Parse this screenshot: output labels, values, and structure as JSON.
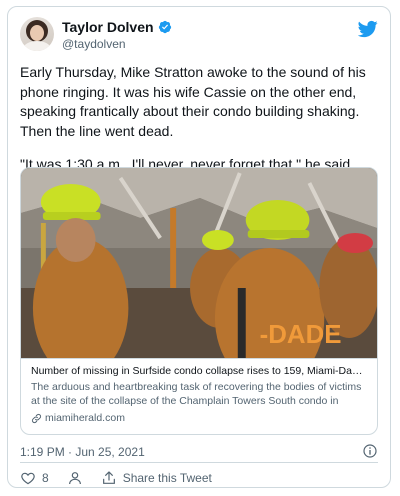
{
  "author": {
    "name": "Taylor Dolven",
    "handle": "@taydolven"
  },
  "tweet": {
    "paragraph_1": "Early Thursday, Mike Stratton awoke to the sound of his phone ringing. It was his wife Cassie on the other end, speaking frantically about their condo building shaking. Then the line went dead.",
    "paragraph_2": "\"It was 1:30 a.m., I'll never, never forget that,\" he said."
  },
  "link_card": {
    "title": "Number of missing in Surfside condo collapse rises to 159, Miami-Dade ...",
    "description": "The arduous and heartbreaking task of recovering the bodies of victims at the site of the collapse of the Champlain Towers South condo in Surfsid...",
    "domain": "miamiherald.com",
    "photo_text": "-DADE"
  },
  "meta": {
    "timestamp": "1:19 PM · Jun 25, 2021"
  },
  "actions": {
    "like_count": "8",
    "share_label": "Share this Tweet"
  },
  "colors": {
    "brand_blue": "#1d9bf0",
    "like_red": "#f91880",
    "text_secondary": "#536471",
    "border": "#cfd9de"
  },
  "icons": [
    "verified-badge-icon",
    "twitter-bird-icon",
    "link-icon",
    "info-icon",
    "heart-icon",
    "person-icon",
    "share-icon"
  ]
}
